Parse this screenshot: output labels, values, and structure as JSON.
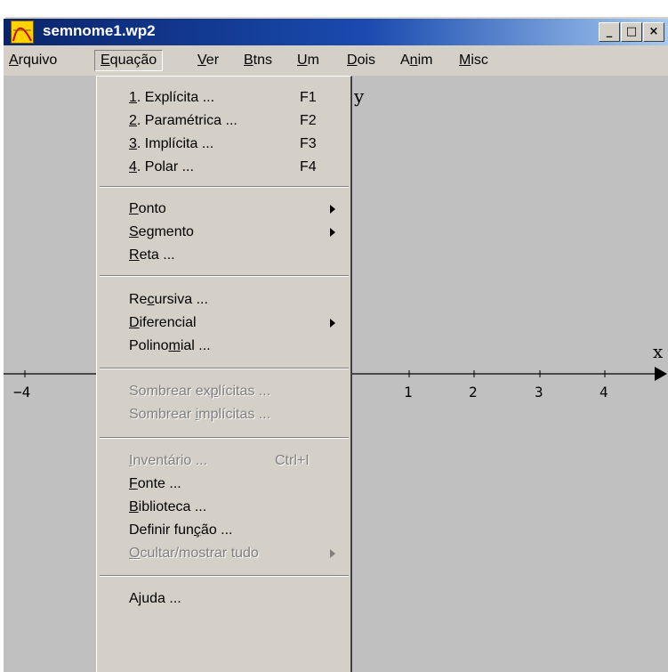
{
  "window": {
    "title": "semnome1.wp2"
  },
  "caption_buttons": {
    "minimize": "_",
    "maximize": "□",
    "close": "×"
  },
  "menubar": [
    {
      "label_pre": "",
      "mn": "A",
      "label_post": "rquivo"
    },
    {
      "label_pre": "",
      "mn": "E",
      "label_post": "quação"
    },
    {
      "label_pre": "",
      "mn": "V",
      "label_post": "er"
    },
    {
      "label_pre": "",
      "mn": "B",
      "label_post": "tns"
    },
    {
      "label_pre": "",
      "mn": "U",
      "label_post": "m"
    },
    {
      "label_pre": "",
      "mn": "D",
      "label_post": "ois"
    },
    {
      "label_pre": "A",
      "mn": "n",
      "label_post": "im"
    },
    {
      "label_pre": "",
      "mn": "M",
      "label_post": "isc"
    }
  ],
  "dropdown": {
    "items": [
      {
        "pre": "",
        "mn": "1",
        "post": ". Explícita ...",
        "key": "F1"
      },
      {
        "pre": "",
        "mn": "2",
        "post": ". Paramétrica ...",
        "key": "F2"
      },
      {
        "pre": "",
        "mn": "3",
        "post": ". Implícita ...",
        "key": "F3"
      },
      {
        "pre": "",
        "mn": "4",
        "post": ". Polar ...",
        "key": "F4"
      },
      {
        "pre": "",
        "mn": "P",
        "post": "onto"
      },
      {
        "pre": "",
        "mn": "S",
        "post": "egmento"
      },
      {
        "pre": "",
        "mn": "R",
        "post": "eta ..."
      },
      {
        "pre": "Re",
        "mn": "c",
        "post": "ursiva ..."
      },
      {
        "pre": "",
        "mn": "D",
        "post": "iferencial"
      },
      {
        "pre": "Polino",
        "mn": "m",
        "post": "ial ..."
      },
      {
        "pre": "Sombrear ex",
        "mn": "p",
        "post": "lícitas ..."
      },
      {
        "pre": "Sombrear ",
        "mn": "i",
        "post": "mplícitas ..."
      },
      {
        "pre": "",
        "mn": "I",
        "post": "nventário ...",
        "key": "Ctrl+I"
      },
      {
        "pre": "",
        "mn": "F",
        "post": "onte ..."
      },
      {
        "pre": "",
        "mn": "B",
        "post": "iblioteca ..."
      },
      {
        "pre": "Definir fun",
        "mn": "ç",
        "post": "ão ..."
      },
      {
        "pre": "",
        "mn": "O",
        "post": "cultar/mostrar tudo"
      },
      {
        "pre": "A",
        "mn": "j",
        "post": "uda ..."
      }
    ]
  },
  "graph": {
    "x_axis_label": "x",
    "y_axis_label": "y",
    "x_tick_labels": [
      "−4",
      "1",
      "2",
      "3",
      "4"
    ]
  },
  "colors": {
    "titlebar_start": "#0a246a",
    "face": "#d4d0c8",
    "canvas": "#c0c0c0",
    "disabled_text": "#808080"
  }
}
